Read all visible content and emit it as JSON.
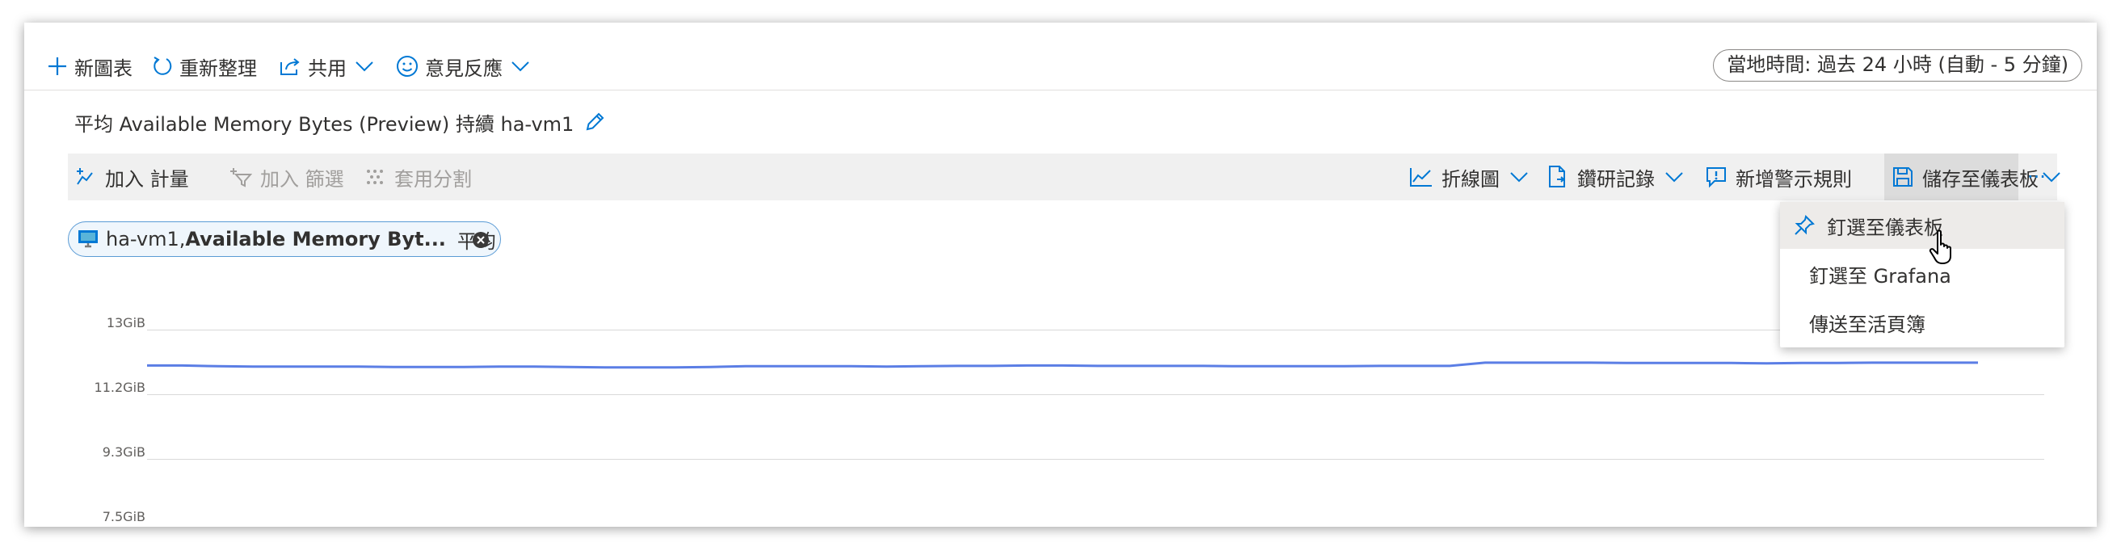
{
  "colors": {
    "accent": "#0078d4",
    "series": "#5b7ee5",
    "pill_border": "#5a9bd5"
  },
  "command_bar": {
    "new_chart": {
      "icon": "plus-icon",
      "label": "新圖表"
    },
    "refresh": {
      "icon": "refresh-icon",
      "label": "重新整理"
    },
    "share": {
      "icon": "share-icon",
      "label": "共用"
    },
    "feedback": {
      "icon": "smiley-icon",
      "label": "意見反應"
    },
    "time_range": "當地時間: 過去 24 小時 (自動 - 5 分鐘)"
  },
  "chart_title": "平均 Available Memory Bytes (Preview) 持續 ha-vm1",
  "toolbar": {
    "add_metric": "加入 計量",
    "add_filter": "加入 篩選",
    "apply_splitting": "套用分割",
    "line_chart": "折線圖",
    "drill_logs": "鑽研記錄",
    "new_alert_rule": "新增警示規則",
    "save_to_dashboard": "儲存至儀表板",
    "more": "···"
  },
  "metric_pill": {
    "resource": "ha-vm1,",
    "metric": "Available Memory Byt...",
    "aggregation": "平均"
  },
  "menu": {
    "items": [
      {
        "label": "釘選至儀表板",
        "icon": "pin-icon"
      },
      {
        "label": "釘選至 Grafana"
      },
      {
        "label": "傳送至活頁簿"
      }
    ]
  },
  "chart_data": {
    "type": "line",
    "y_ticks": [
      "13GiB",
      "11.2GiB",
      "9.3GiB",
      "7.5GiB"
    ],
    "y_tick_values": [
      13,
      11.2,
      9.3,
      7.5
    ],
    "x_axis_labels": [],
    "series": [
      {
        "values": [
          12.0,
          12.0,
          11.98,
          11.97,
          11.97,
          11.97,
          11.97,
          11.96,
          11.96,
          11.96,
          11.97,
          11.97,
          11.96,
          11.95,
          11.95,
          11.95,
          11.96,
          11.98,
          11.98,
          11.98,
          11.98,
          11.97,
          11.98,
          11.99,
          11.99,
          12.0,
          12.0,
          11.99,
          11.99,
          11.99,
          11.99,
          11.98,
          11.98,
          11.98,
          11.98,
          11.99,
          11.99,
          11.99,
          12.08,
          12.08,
          12.08,
          12.08,
          12.07,
          12.07,
          12.07,
          12.07,
          12.06,
          12.07,
          12.07,
          12.08,
          12.08,
          12.08,
          12.08
        ]
      }
    ]
  }
}
